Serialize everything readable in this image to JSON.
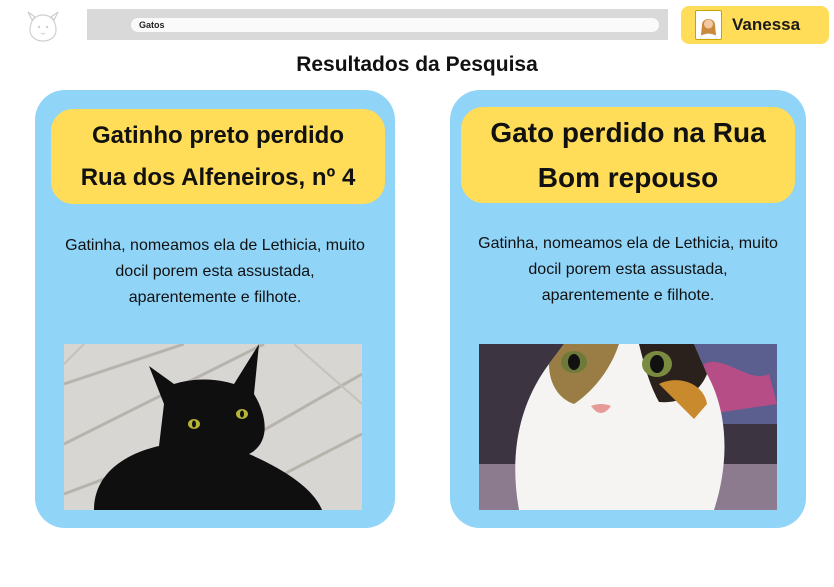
{
  "header": {
    "logo_name": "paw-dog-logo",
    "search": {
      "value": "Gatos"
    },
    "user": {
      "name": "Vanessa"
    }
  },
  "page": {
    "title": "Resultados da Pesquisa"
  },
  "results": [
    {
      "title_line1": "Gatinho preto perdido",
      "title_line2": "Rua dos Alfeneiros, nº 4",
      "desc_line1": "Gatinha, nomeamos ela de Lethicia, muito",
      "desc_line2": "docil porem esta assustada,",
      "desc_line3": "aparentemente e filhote.",
      "photo": "black-cat-photo"
    },
    {
      "title_line1": "Gato perdido na Rua",
      "title_line2": "Bom repouso",
      "desc_line1": "Gatinha, nomeamos ela de Lethicia, muito",
      "desc_line2": "docil porem esta assustada,",
      "desc_line3": "aparentemente e filhote.",
      "photo": "calico-cat-photo"
    }
  ],
  "colors": {
    "card_bg": "#90d4f8",
    "accent_yellow": "#ffdd59",
    "search_bg": "#d9d9d9"
  }
}
